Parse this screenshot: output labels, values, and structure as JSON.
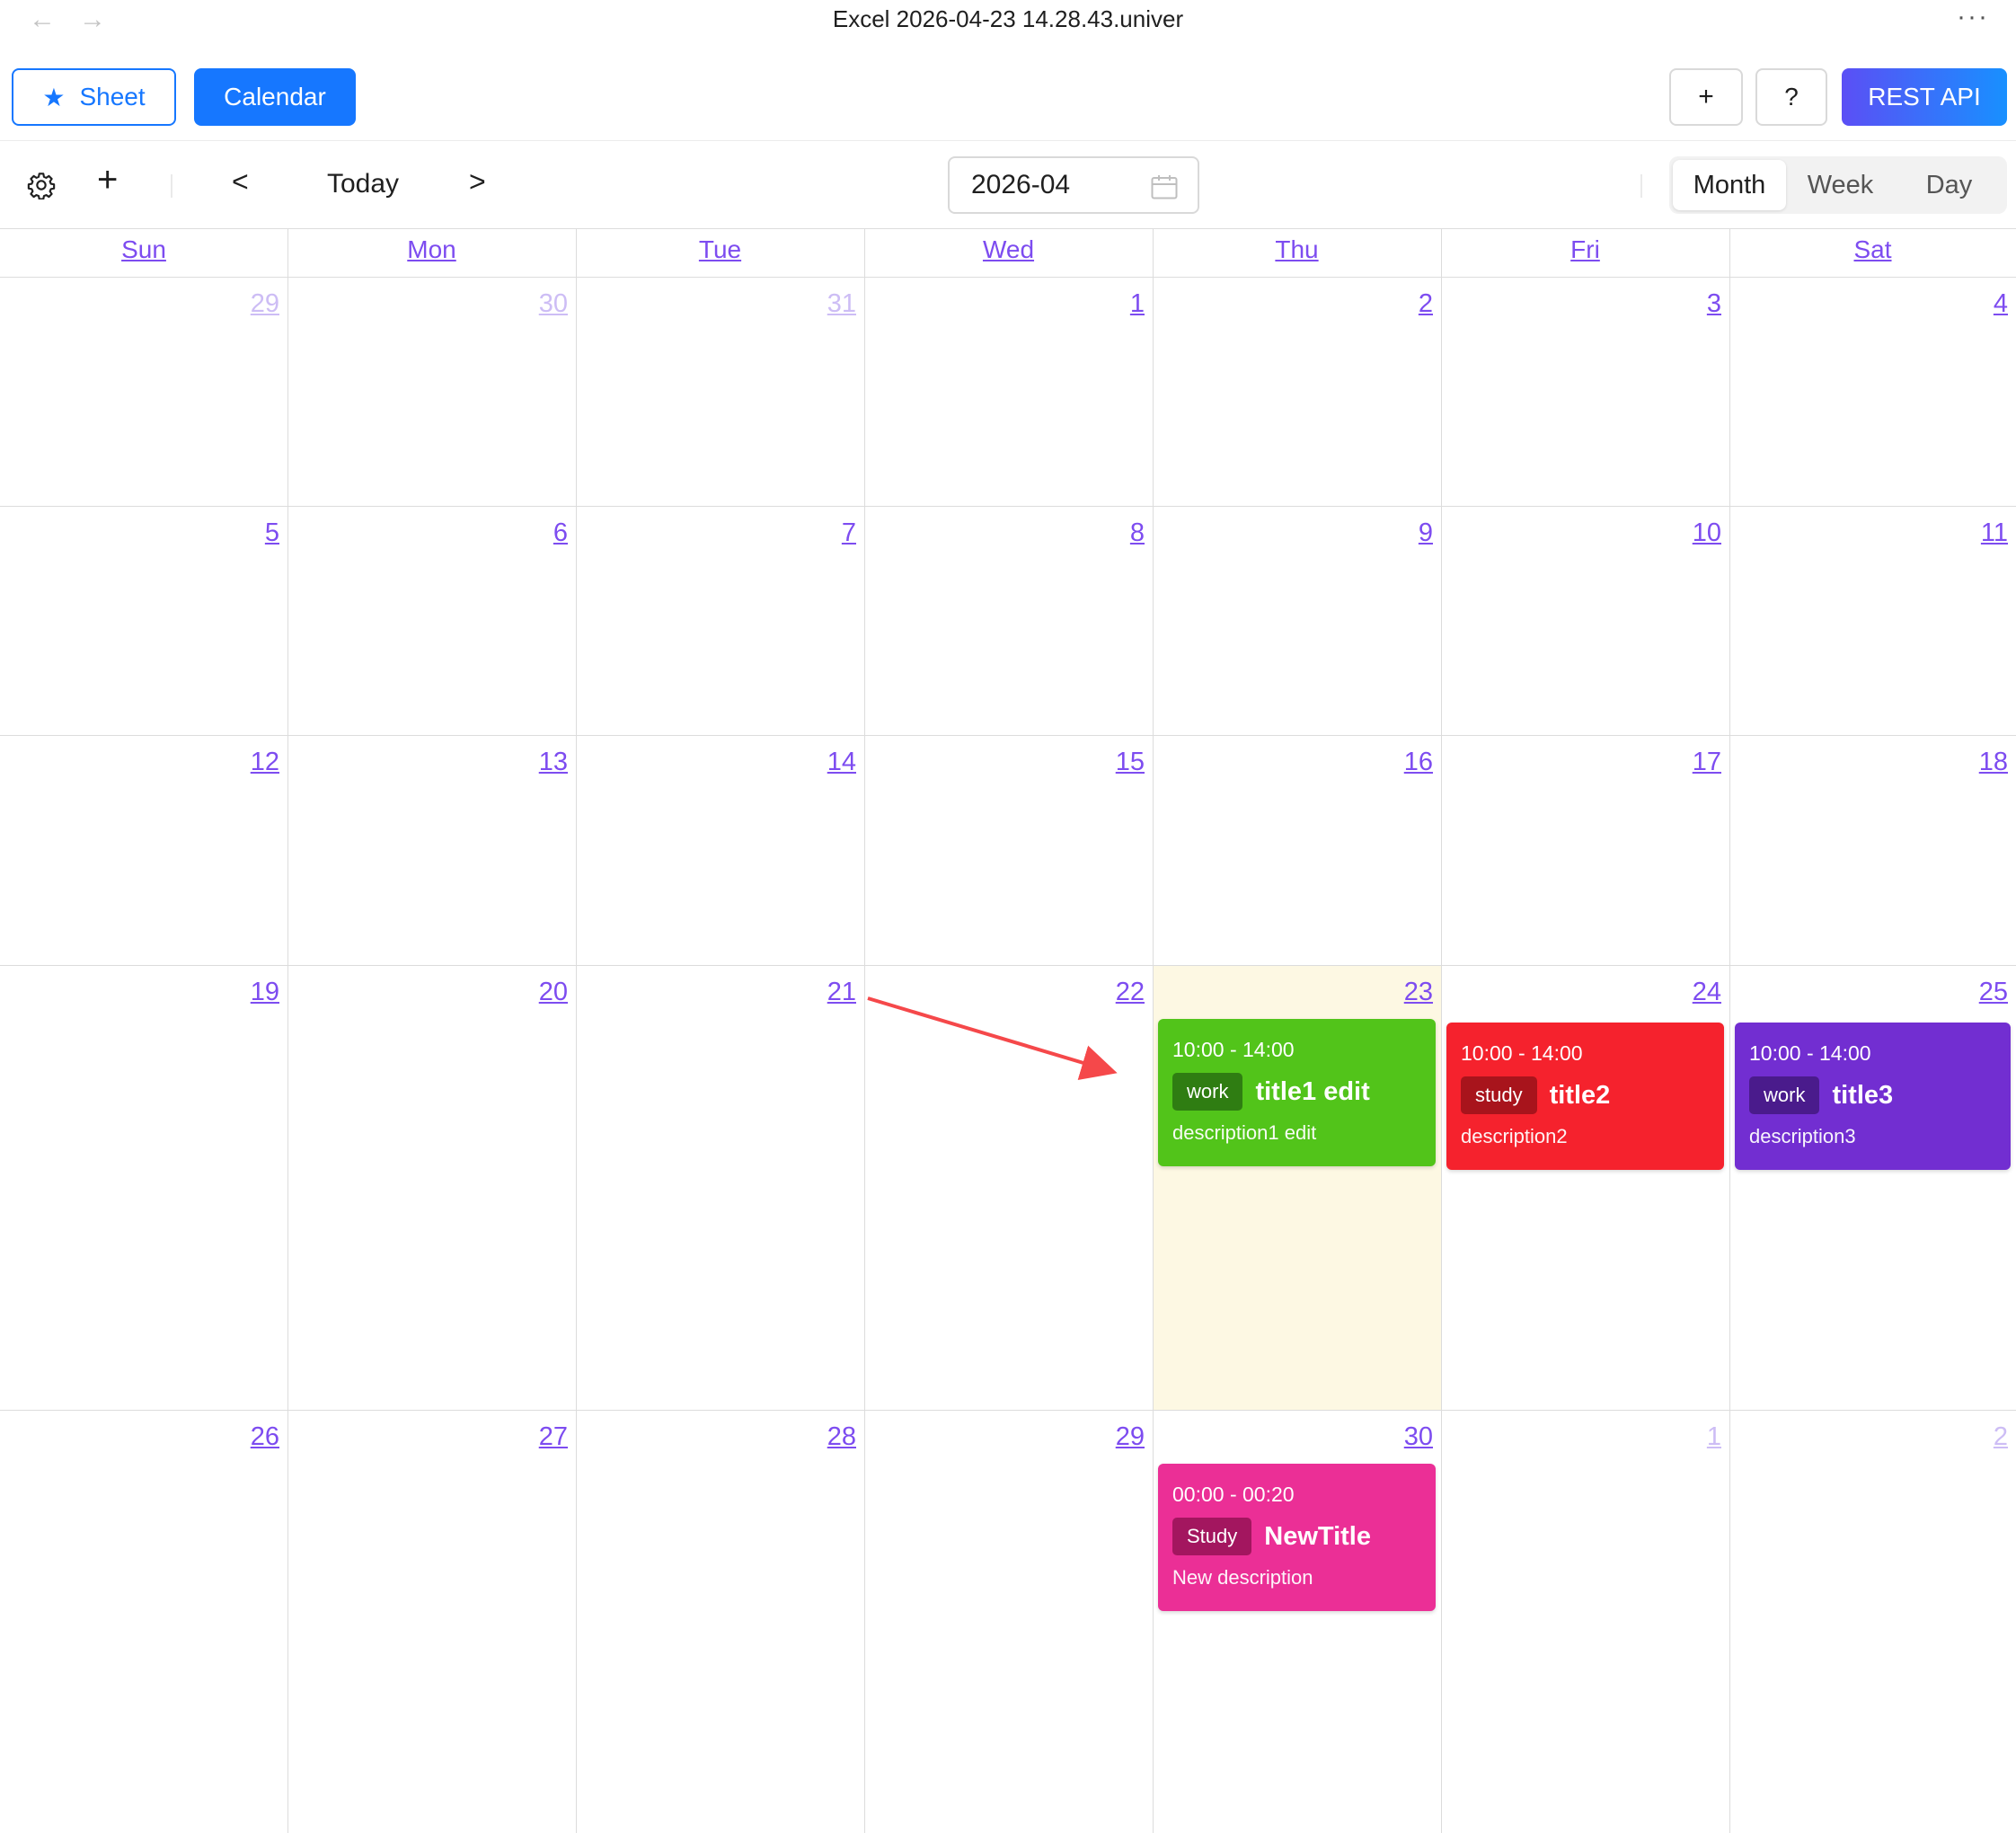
{
  "window": {
    "title": "Excel 2026-04-23 14.28.43.univer",
    "back_glyph": "←",
    "forward_glyph": "→",
    "more_glyph": "···"
  },
  "topbar": {
    "sheet_label": "Sheet",
    "calendar_label": "Calendar",
    "plus_label": "+",
    "help_label": "?",
    "rest_label": "REST API"
  },
  "calbar": {
    "add_glyph": "+",
    "prev_label": "<",
    "today_label": "Today",
    "next_label": ">",
    "current_month": "2026-04",
    "views": [
      "Month",
      "Week",
      "Day"
    ],
    "active_view": "Month"
  },
  "weekdays": [
    "Sun",
    "Mon",
    "Tue",
    "Wed",
    "Thu",
    "Fri",
    "Sat"
  ],
  "weeks": [
    [
      {
        "d": "29",
        "m": true
      },
      {
        "d": "30",
        "m": true
      },
      {
        "d": "31",
        "m": true
      },
      {
        "d": "1"
      },
      {
        "d": "2"
      },
      {
        "d": "3"
      },
      {
        "d": "4"
      }
    ],
    [
      {
        "d": "5"
      },
      {
        "d": "6"
      },
      {
        "d": "7"
      },
      {
        "d": "8"
      },
      {
        "d": "9"
      },
      {
        "d": "10"
      },
      {
        "d": "11"
      }
    ],
    [
      {
        "d": "12"
      },
      {
        "d": "13"
      },
      {
        "d": "14"
      },
      {
        "d": "15"
      },
      {
        "d": "16"
      },
      {
        "d": "17"
      },
      {
        "d": "18"
      }
    ],
    [
      {
        "d": "19"
      },
      {
        "d": "20"
      },
      {
        "d": "21"
      },
      {
        "d": "22"
      },
      {
        "d": "23"
      },
      {
        "d": "24"
      },
      {
        "d": "25"
      }
    ],
    [
      {
        "d": "26"
      },
      {
        "d": "27"
      },
      {
        "d": "28"
      },
      {
        "d": "29"
      },
      {
        "d": "30"
      },
      {
        "d": "1",
        "m": true
      },
      {
        "d": "2",
        "m": true
      }
    ]
  ],
  "today": {
    "week": 3,
    "day": 4
  },
  "events": [
    {
      "week": 3,
      "day": 4,
      "time": "10:00 - 14:00",
      "tag": "work",
      "title": "title1 edit",
      "description": "description1 edit",
      "color": "#52c41a",
      "tag_color": "#2f7d12"
    },
    {
      "week": 3,
      "day": 5,
      "time": "10:00 - 14:00",
      "tag": "study",
      "title": "title2",
      "description": "description2",
      "color": "#f5222d",
      "tag_color": "#a8141c"
    },
    {
      "week": 3,
      "day": 6,
      "time": "10:00 - 14:00",
      "tag": "work",
      "title": "title3",
      "description": "description3",
      "color": "#722ed1",
      "tag_color": "#4a1b8c"
    },
    {
      "week": 4,
      "day": 4,
      "time": "00:00 - 00:20",
      "tag": "Study",
      "title": "NewTitle",
      "description": "New description",
      "color": "#eb2f96",
      "tag_color": "#a3165f"
    }
  ],
  "colors": {
    "accent": "#1677ff",
    "link": "#7d4cf0",
    "today_bg": "#fdf8e3",
    "annotation_arrow": "#f5484a"
  }
}
